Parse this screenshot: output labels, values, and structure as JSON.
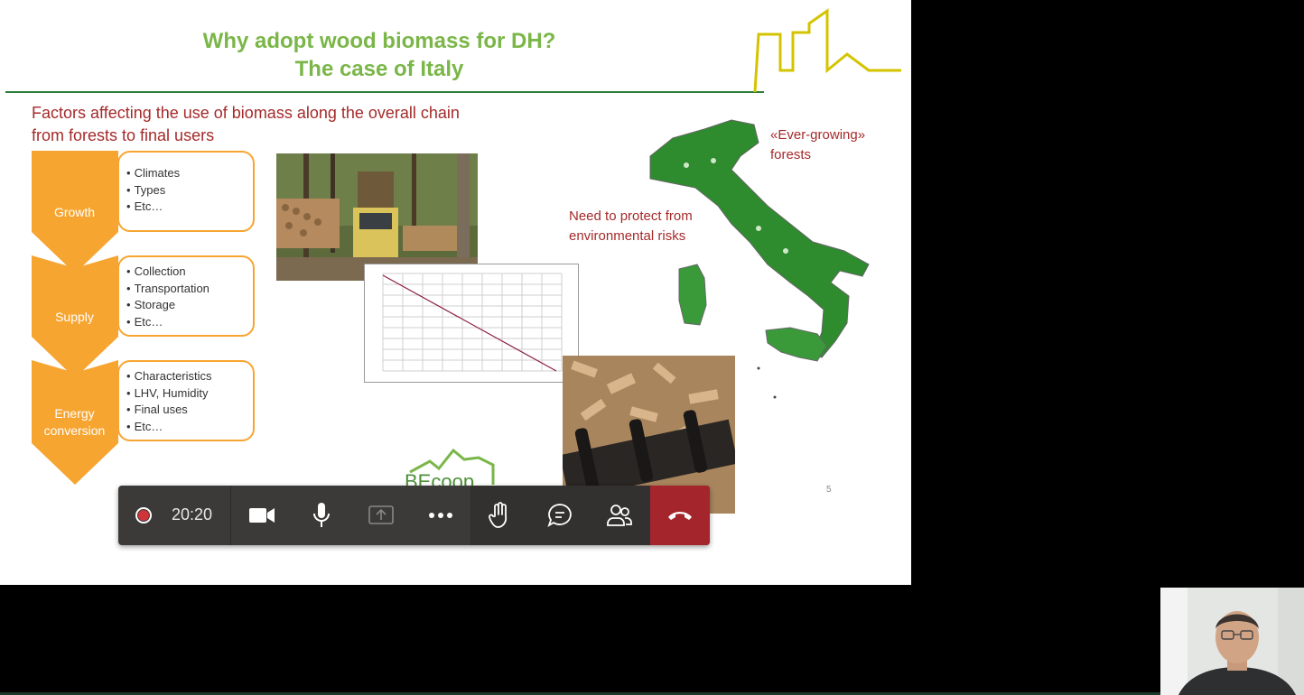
{
  "slide": {
    "title_line1": "Why adopt wood biomass for DH?",
    "title_line2": "The case of Italy",
    "subtitle_line1": "Factors affecting the use of biomass along the overall chain",
    "subtitle_line2": "from forests to final users",
    "stages": [
      {
        "label": "Growth",
        "items": [
          "Climates",
          "Types",
          "Etc…"
        ]
      },
      {
        "label": "Supply",
        "items": [
          "Collection",
          "Transportation",
          "Storage",
          "Etc…"
        ]
      },
      {
        "label": "Energy conversion",
        "items": [
          "Characteristics",
          "LHV, Humidity",
          "Final uses",
          "Etc…"
        ]
      }
    ],
    "note_forests_line1": "«Ever-growing»",
    "note_forests_line2": "forests",
    "note_risks_line1": "Need to protect from",
    "note_risks_line2": "environmental risks",
    "page_number": "5",
    "logo_text": "BEcoop",
    "accent_orange": "#f7a531",
    "title_green": "#7ab648",
    "note_red": "#a52a2a"
  },
  "call_controls": {
    "timer": "20:20",
    "recording_color": "#d13438",
    "hangup_color": "#a4262c",
    "buttons": [
      {
        "name": "camera",
        "icon": "video-camera-icon"
      },
      {
        "name": "microphone",
        "icon": "microphone-icon"
      },
      {
        "name": "share",
        "icon": "share-screen-icon"
      },
      {
        "name": "more",
        "icon": "more-options-icon"
      },
      {
        "name": "raise-hand",
        "icon": "raise-hand-icon"
      },
      {
        "name": "chat",
        "icon": "chat-icon"
      },
      {
        "name": "participants",
        "icon": "participants-icon"
      },
      {
        "name": "leave",
        "icon": "hang-up-icon"
      }
    ]
  }
}
